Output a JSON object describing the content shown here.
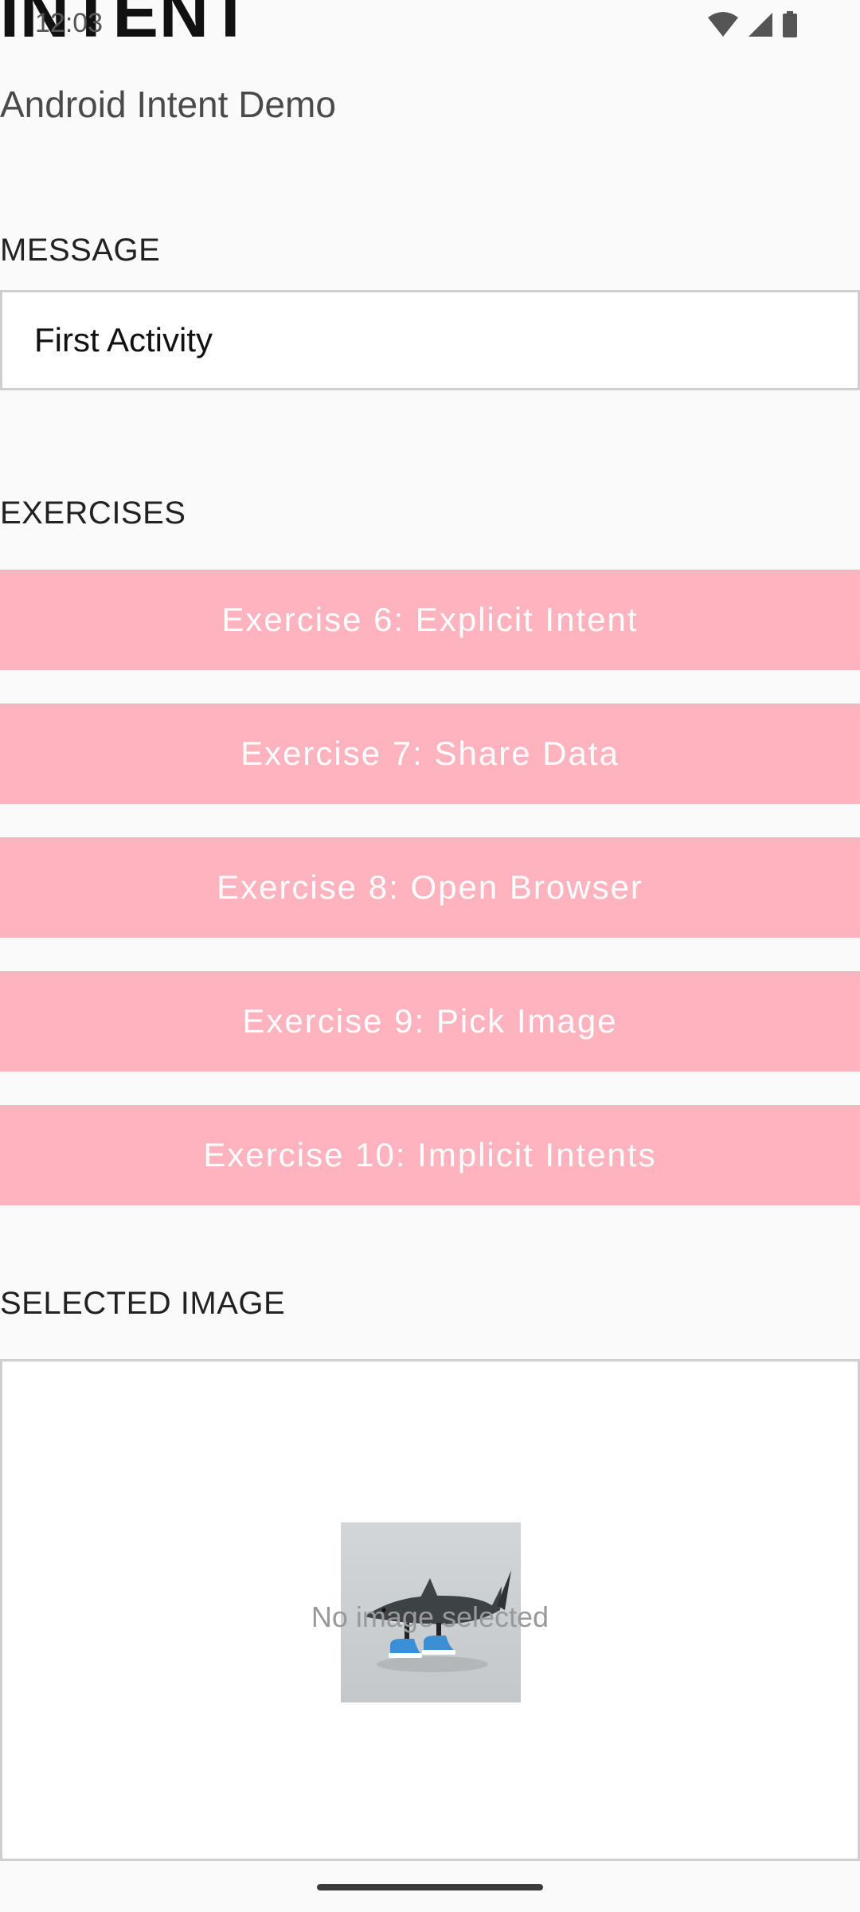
{
  "status_bar": {
    "time": "12:03",
    "icons": [
      "wifi-icon",
      "cellular-signal-icon",
      "battery-icon"
    ]
  },
  "header": {
    "title": "INTENT",
    "subtitle": "Android Intent Demo"
  },
  "message_section": {
    "label": "MESSAGE",
    "input_value": "First Activity"
  },
  "exercises_section": {
    "label": "EXERCISES",
    "buttons": [
      {
        "label": "Exercise 6: Explicit Intent"
      },
      {
        "label": "Exercise 7: Share Data"
      },
      {
        "label": "Exercise 8: Open Browser"
      },
      {
        "label": "Exercise 9: Pick Image"
      },
      {
        "label": "Exercise 10: Implicit Intents"
      }
    ]
  },
  "selected_image_section": {
    "label": "SELECTED IMAGE",
    "placeholder_text": "No image selected",
    "thumbnail": "shark-with-sneakers-image"
  },
  "colors": {
    "button_background": "#ffb3be",
    "button_text": "#ffffff",
    "background": "#fafafa",
    "border": "#cfcfcf"
  }
}
